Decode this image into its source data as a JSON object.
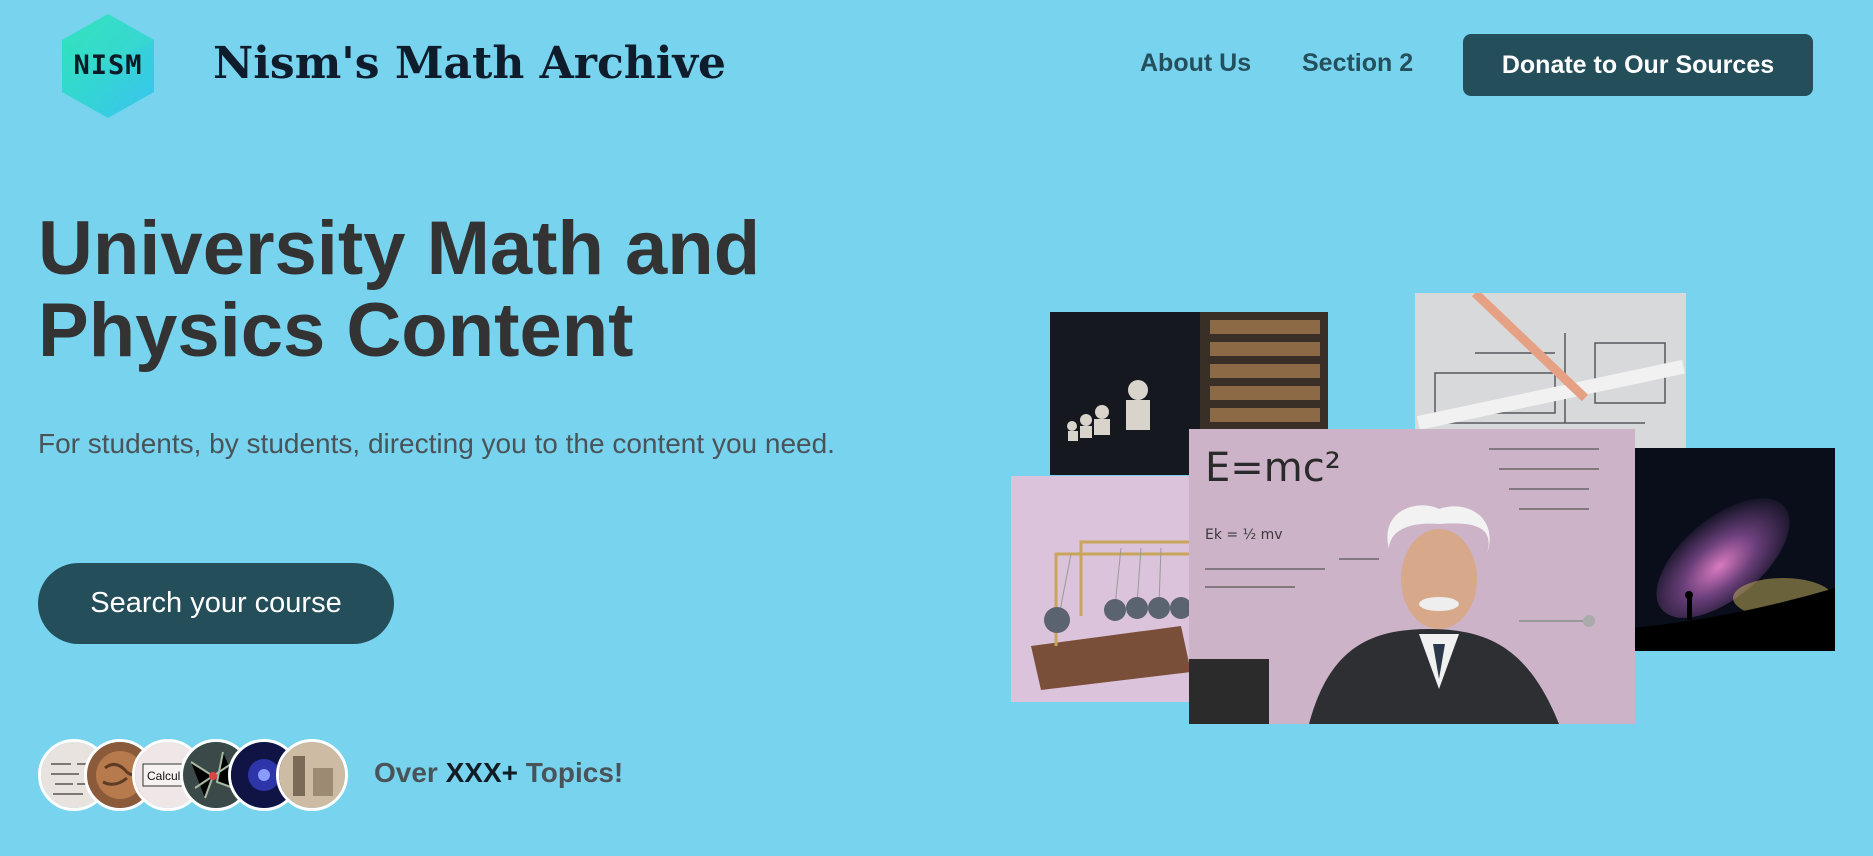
{
  "header": {
    "logo_text": "NISM",
    "site_title": "Nism's Math Archive",
    "nav": [
      {
        "label": "About Us"
      },
      {
        "label": "Section 2"
      }
    ],
    "donate_label": "Donate to Our Sources"
  },
  "hero": {
    "title_line1": "University Math and",
    "title_line2": "Physics Content",
    "subtitle": "For students, by students, directing you to the content you need.",
    "search_button_label": "Search your course"
  },
  "topics": {
    "prefix": "Over ",
    "count": "XXX+",
    "suffix": " Topics!",
    "avatars": [
      {
        "name": "handwritten-equations-avatar"
      },
      {
        "name": "globe-avatar"
      },
      {
        "name": "calculus-book-avatar",
        "label": "Calculus"
      },
      {
        "name": "circuit-avatar"
      },
      {
        "name": "plasma-avatar"
      },
      {
        "name": "lab-equipment-avatar"
      }
    ]
  },
  "gallery": {
    "einstein_board": {
      "formula": "E=mc²",
      "fragment": "Ek = ½ mv"
    }
  },
  "colors": {
    "background": "#78d3ef",
    "accent": "#234e5a",
    "logo_gradient_start": "#2ee6b6",
    "logo_gradient_end": "#3ac4f0"
  }
}
